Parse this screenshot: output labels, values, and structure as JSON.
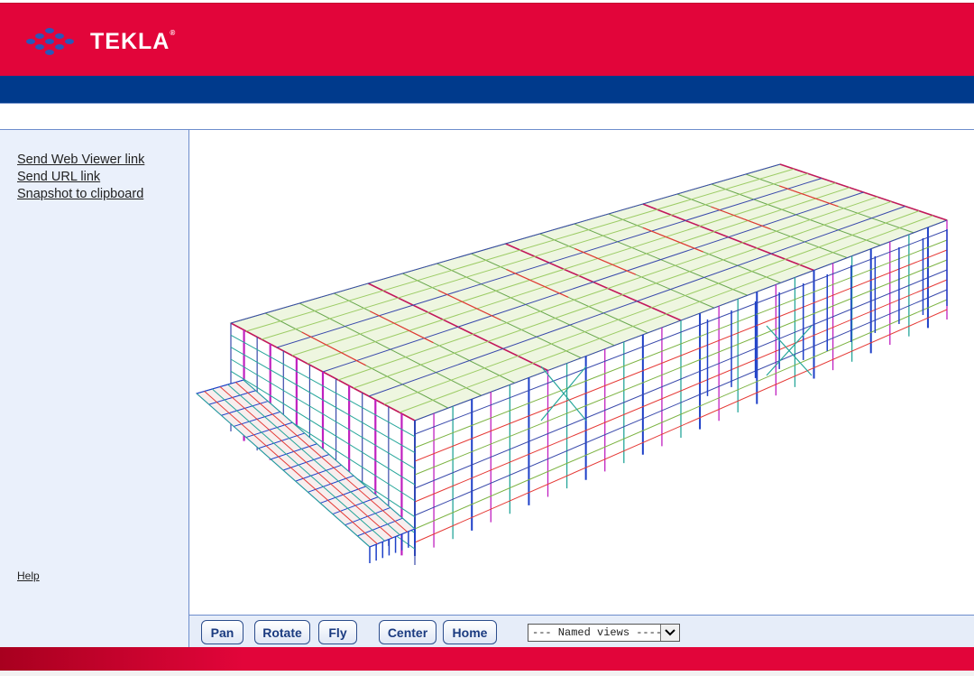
{
  "brand": {
    "name": "TEKLA",
    "mark": "®",
    "logo_icon": "tekla-dots-logo-icon"
  },
  "sidebar": {
    "links": [
      {
        "label": "Send Web Viewer link"
      },
      {
        "label": "Send URL link"
      },
      {
        "label": "Snapshot to clipboard"
      }
    ],
    "help_label": "Help"
  },
  "toolbar": {
    "buttons": [
      {
        "label": "Pan"
      },
      {
        "label": "Rotate"
      },
      {
        "label": "Fly"
      },
      {
        "label": "Center"
      },
      {
        "label": "Home"
      }
    ],
    "named_views": {
      "selected": "--- Named views ----"
    }
  },
  "colors": {
    "header_red": "#e2053a",
    "header_blue": "#003a8c",
    "sidebar_bg": "#eaf0fb",
    "border_blue": "#6d8dcc"
  }
}
